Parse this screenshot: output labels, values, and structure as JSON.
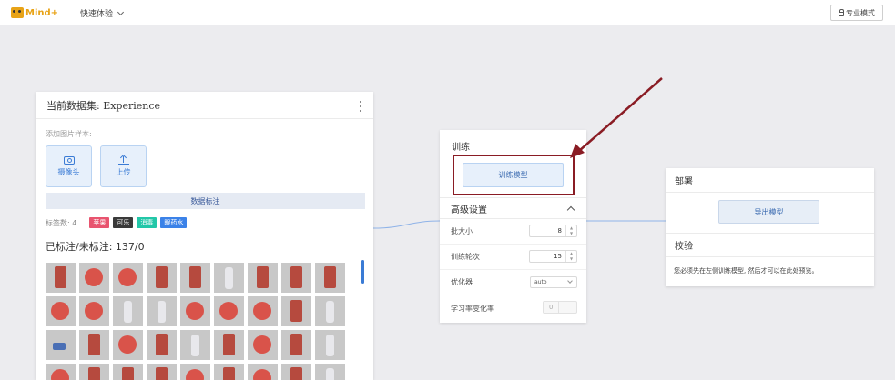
{
  "header": {
    "logo_text": "Mind+",
    "quick_menu_label": "快速体验",
    "pro_mode_label": "专业模式"
  },
  "dataset": {
    "title": "当前数据集: Experience",
    "add_samples_label": "添加图片样本:",
    "camera_label": "摄像头",
    "upload_label": "上传",
    "annotate_label": "数据标注",
    "tag_count_label": "标签数: 4",
    "tags": [
      {
        "label": "苹果",
        "color": "#e8546f"
      },
      {
        "label": "可乐",
        "color": "#3a3a3a"
      },
      {
        "label": "消毒",
        "color": "#22c7a8"
      },
      {
        "label": "眼药水",
        "color": "#3b82e8"
      }
    ],
    "summary": "已标注/未标注: 137/0"
  },
  "train": {
    "title": "训练",
    "train_button": "训练模型",
    "advanced_label": "高级设置",
    "params": [
      {
        "label": "批大小",
        "value": "8"
      },
      {
        "label": "训练轮次",
        "value": "15"
      },
      {
        "label": "优化器",
        "value": "auto"
      },
      {
        "label": "学习率变化率",
        "value": "0."
      }
    ]
  },
  "deploy": {
    "title": "部署",
    "export_button": "导出模型",
    "verify_title": "校验",
    "verify_message": "您必须先在左侧训练模型, 然后才可以在此处预览。"
  },
  "colors": {
    "highlight_box": "#8a1c24",
    "connector": "#8fb3e8",
    "accent": "#3a7bd5"
  }
}
